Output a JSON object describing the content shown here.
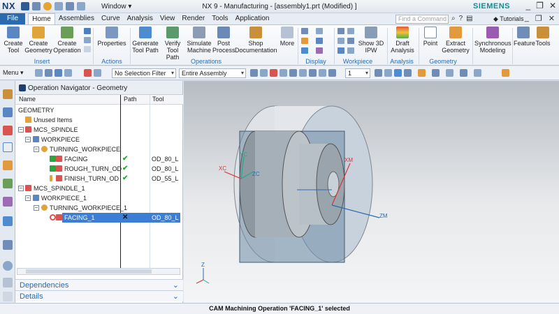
{
  "titlebar": {
    "logo": "NX",
    "window_menu": "Window ▾",
    "title": "NX 9 - Manufacturing - [assembly1.prt (Modified) ]",
    "brand": "SIEMENS",
    "controls": [
      "_",
      "❐",
      "✕"
    ]
  },
  "tabs": {
    "file": "File",
    "items": [
      "Home",
      "Assemblies",
      "Curve",
      "Analysis",
      "View",
      "Render",
      "Tools",
      "Application"
    ],
    "active": "Home",
    "find_placeholder": "Find a Command",
    "tutorials": "Tutorials",
    "doc_controls": [
      "_",
      "❐",
      "✕"
    ]
  },
  "ribbon": {
    "buttons": [
      {
        "label": "Create\nTool",
        "icon": "create-tool-icon"
      },
      {
        "label": "Create\nGeometry",
        "icon": "create-geometry-icon"
      },
      {
        "label": "Create\nOperation",
        "icon": "create-operation-icon"
      },
      {
        "label": "Properties",
        "icon": "properties-icon"
      },
      {
        "label": "Generate\nTool Path",
        "icon": "generate-toolpath-icon"
      },
      {
        "label": "Verify\nTool Path",
        "icon": "verify-toolpath-icon"
      },
      {
        "label": "Simulate\nMachine",
        "icon": "simulate-machine-icon"
      },
      {
        "label": "Post\nProcess",
        "icon": "post-process-icon"
      },
      {
        "label": "Shop\nDocumentation",
        "icon": "shop-documentation-icon"
      },
      {
        "label": "More",
        "icon": "more-icon"
      },
      {
        "label": "Show 3D\nIPW",
        "icon": "show-3d-ipw-icon"
      },
      {
        "label": "Draft\nAnalysis",
        "icon": "draft-analysis-icon"
      },
      {
        "label": "Point",
        "icon": "point-icon"
      },
      {
        "label": "Extract\nGeometry",
        "icon": "extract-geometry-icon"
      },
      {
        "label": "Synchronous\nModeling",
        "icon": "synchronous-modeling-icon"
      },
      {
        "label": "Feature",
        "icon": "feature-icon"
      },
      {
        "label": "Tools",
        "icon": "tools-icon"
      }
    ],
    "groups": [
      "Insert",
      "Actions",
      "Operations",
      "Display",
      "Workpiece",
      "Analysis",
      "Geometry"
    ]
  },
  "toolbar2": {
    "menu": "Menu ▾",
    "selection_filter": "No Selection Filter",
    "scope": "Entire Assembly",
    "counter": "1"
  },
  "navigator": {
    "title": "Operation Navigator - Geometry",
    "columns": [
      "Name",
      "Path",
      "Tool"
    ],
    "rows": [
      {
        "name": "GEOMETRY",
        "path": "",
        "tool": ""
      },
      {
        "name": "Unused Items",
        "path": "",
        "tool": ""
      },
      {
        "name": "MCS_SPINDLE",
        "path": "",
        "tool": ""
      },
      {
        "name": "WORKPIECE",
        "path": "",
        "tool": ""
      },
      {
        "name": "TURNING_WORKPIECE",
        "path": "",
        "tool": ""
      },
      {
        "name": "FACING",
        "path": "✔",
        "tool": "OD_80_L"
      },
      {
        "name": "ROUGH_TURN_OD",
        "path": "✔",
        "tool": "OD_80_L"
      },
      {
        "name": "FINISH_TURN_OD",
        "path": "✔",
        "tool": "OD_55_L"
      },
      {
        "name": "MCS_SPINDLE_1",
        "path": "",
        "tool": ""
      },
      {
        "name": "WORKPIECE_1",
        "path": "",
        "tool": ""
      },
      {
        "name": "TURNING_WORKPIECE_1",
        "path": "",
        "tool": ""
      },
      {
        "name": "FACING_1",
        "path": "✕",
        "tool": "OD_80_L"
      }
    ],
    "panels": [
      "Dependencies",
      "Details"
    ],
    "panel_chevron": "⌄"
  },
  "viewport": {
    "axis_labels": [
      "XC",
      "ZC",
      "YC",
      "XM",
      "ZM",
      "Z"
    ]
  },
  "status": {
    "message": "CAM Machining Operation 'FACING_1' selected"
  }
}
